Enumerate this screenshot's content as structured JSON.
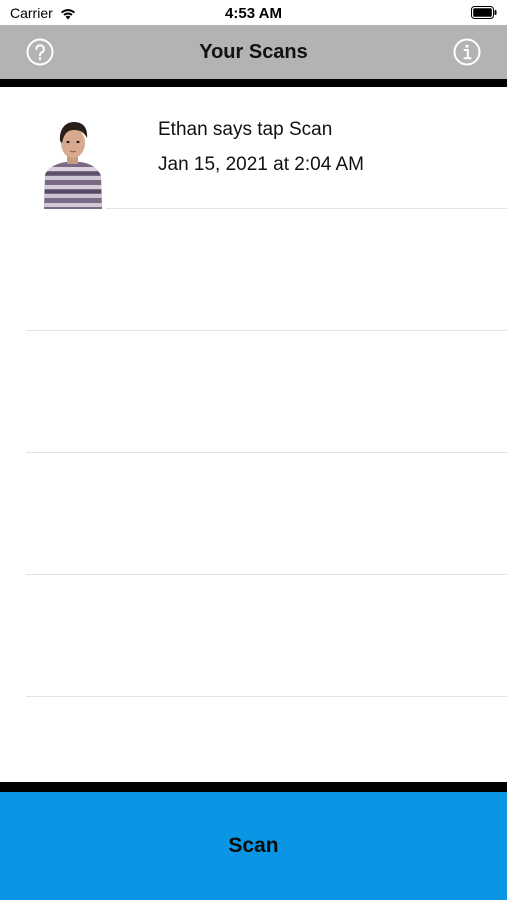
{
  "status_bar": {
    "carrier": "Carrier",
    "time": "4:53 AM"
  },
  "nav": {
    "title": "Your Scans",
    "left_icon": "help-icon",
    "right_icon": "info-icon",
    "background_color": "#b3b3b3"
  },
  "scans": [
    {
      "title": "Ethan says tap Scan",
      "date": "Jan 15, 2021 at 2:04 AM",
      "thumbnail_icon": "scan-thumbnail-child"
    }
  ],
  "scan_button": {
    "label": "Scan",
    "color": "#0a96e4"
  }
}
